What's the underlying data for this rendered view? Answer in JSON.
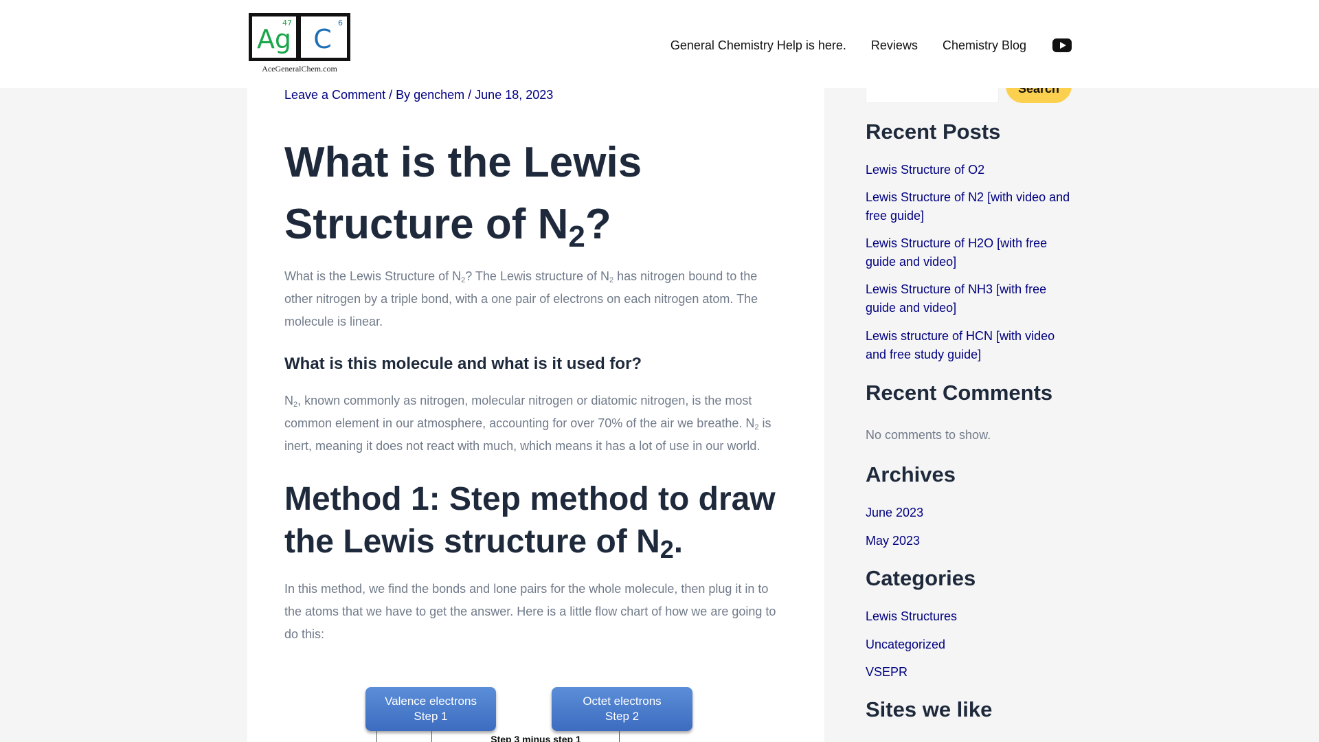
{
  "header": {
    "logo": {
      "ag_symbol": "Ag",
      "ag_number": "47",
      "c_symbol": "C",
      "c_number": "6",
      "caption": "AceGeneralChem.com"
    },
    "nav": {
      "item1": "General Chemistry Help is here.",
      "item2": "Reviews",
      "item3": "Chemistry Blog",
      "icon": "youtube-icon"
    }
  },
  "article": {
    "meta": {
      "comment_link": "Leave a Comment",
      "by_text": " / By ",
      "author": "genchem",
      "date_sep": " / ",
      "date": "June 18, 2023"
    },
    "title": {
      "part1": "What is the Lewis Structure of N",
      "sub": "2",
      "part2": "?"
    },
    "intro": {
      "t1": "What is the Lewis Structure of N",
      "s1": "2",
      "t2": "? The Lewis structure of N",
      "s2": "2",
      "t3": " has nitrogen bound to the other nitrogen by a triple bond, with a one pair of electrons on each nitrogen atom. The molecule is linear."
    },
    "subheading": "What is this molecule and what is it used for?",
    "usage": {
      "t1": "N",
      "s1": "2",
      "t2": ", known commonly as nitrogen, molecular nitrogen or diatomic nitrogen, is the most common element in our atmosphere, accounting for over 70% of the air we breathe. N",
      "s2": "2",
      "t3": " is inert, meaning it does not react with much, which means it has a lot of use in our world."
    },
    "method_heading": {
      "part1": "Method 1: Step method to draw the Lewis structure of N",
      "sub": "2",
      "part2": "."
    },
    "method_text": "In this method, we find the bonds and lone pairs for the whole molecule, then plug it in to the atoms that we have to get the answer. Here is a little flow chart of how we are going to do this:",
    "flowchart": {
      "box1_line1": "Valence electrons",
      "box1_line2": "Step 1",
      "box2_line1": "Octet electrons",
      "box2_line2": "Step 2",
      "step3_label": "Step 3 minus step 1"
    }
  },
  "sidebar": {
    "search_button": "Search",
    "recent_posts": {
      "title": "Recent Posts",
      "items": [
        "Lewis Structure of O2",
        "Lewis Structure of N2 [with video and free guide]",
        "Lewis Structure of H2O [with free guide and video]",
        "Lewis Structure of NH3 [with free guide and video]",
        "Lewis structure of HCN [with video and free study guide]"
      ]
    },
    "recent_comments": {
      "title": "Recent Comments",
      "empty": "No comments to show."
    },
    "archives": {
      "title": "Archives",
      "items": [
        "June 2023",
        "May 2023"
      ]
    },
    "categories": {
      "title": "Categories",
      "items": [
        "Lewis Structures",
        "Uncategorized",
        "VSEPR"
      ]
    },
    "sites": {
      "title": "Sites we like"
    }
  },
  "colors": {
    "link": "#000080",
    "heading": "#1e293b",
    "body_text": "#707a89",
    "search_button": "#fcd04f",
    "background": "#f5f5f5"
  }
}
